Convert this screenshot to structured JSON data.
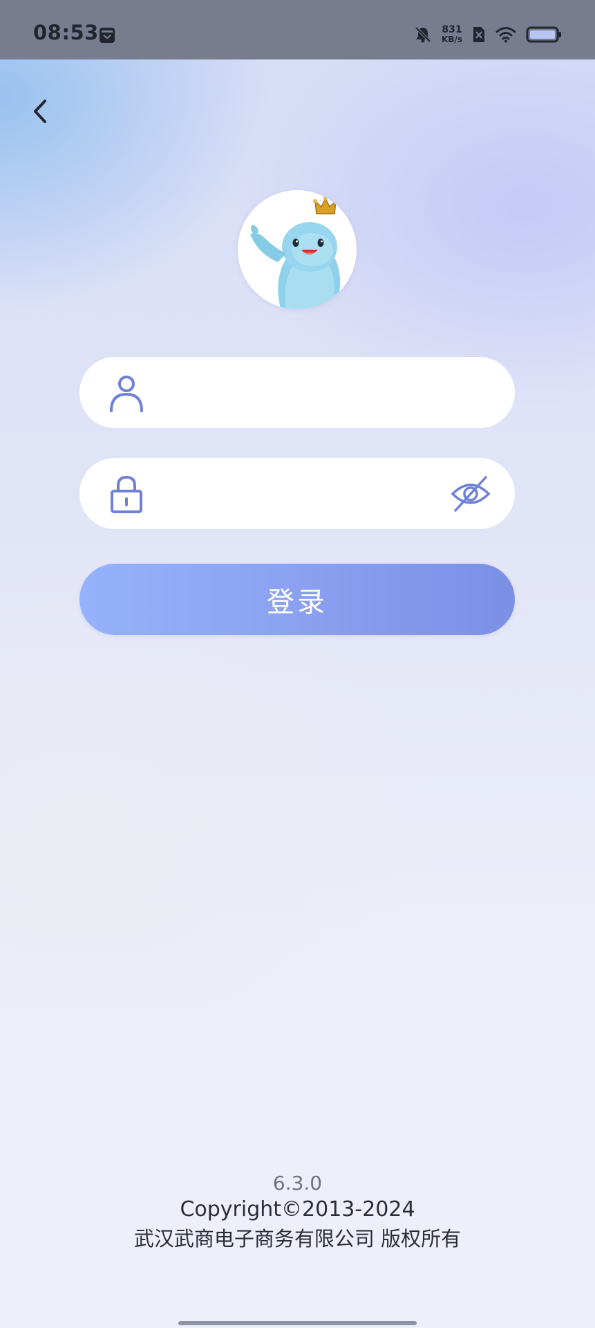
{
  "status_bar": {
    "time": "08:53",
    "net_speed_value": "831",
    "net_speed_unit": "KB/s",
    "icons": [
      "app-notification-icon",
      "mute-icon",
      "sim-none-icon",
      "wifi-icon",
      "battery-icon"
    ]
  },
  "nav": {
    "back_icon": "chevron-left-icon"
  },
  "login_form": {
    "username": {
      "icon": "user-icon",
      "value": "",
      "placeholder": ""
    },
    "password": {
      "icon": "lock-icon",
      "value": "",
      "placeholder": "",
      "toggle_icon": "eye-off-icon"
    },
    "login_label": "登录"
  },
  "footer": {
    "version": "6.3.0",
    "copyright": "Copyright©2013-2024",
    "company": "武汉武商电子商务有限公司 版权所有"
  },
  "colors": {
    "accent": "#6f80d8",
    "button_gradient_start": "#96b2fc",
    "button_gradient_end": "#7b8fe5",
    "status_bar": "#777d8f"
  }
}
